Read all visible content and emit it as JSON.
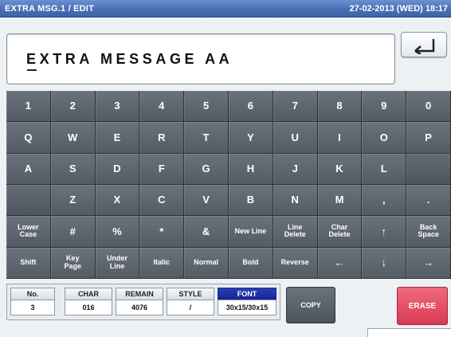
{
  "header": {
    "title": "EXTRA MSG.1 / EDIT",
    "datetime": "27-02-2013 (WED) 18:17"
  },
  "message": {
    "text": "EXTRA MESSAGE AA"
  },
  "icons": {
    "back": "return-arrow-icon"
  },
  "keyboard": {
    "rows": [
      [
        "1",
        "2",
        "3",
        "4",
        "5",
        "6",
        "7",
        "8",
        "9",
        "0"
      ],
      [
        "Q",
        "W",
        "E",
        "R",
        "T",
        "Y",
        "U",
        "I",
        "O",
        "P"
      ],
      [
        "A",
        "S",
        "D",
        "F",
        "G",
        "H",
        "J",
        "K",
        "L",
        ""
      ],
      [
        "",
        "Z",
        "X",
        "C",
        "V",
        "B",
        "N",
        "M",
        ",",
        "."
      ],
      [
        "Lower\nCase",
        "#",
        "%",
        "*",
        "&",
        "New Line",
        "Line\nDelete",
        "Char\nDelete",
        "↑",
        "Back\nSpace"
      ],
      [
        "Shift",
        "Key\nPage",
        "Under\nLine",
        "Italic",
        "Normal",
        "Bold",
        "Reverse",
        "←",
        "↓",
        "→"
      ]
    ]
  },
  "status": {
    "no_label": "No.",
    "no_value": "3",
    "char_label": "CHAR",
    "char_value": "016",
    "remain_label": "REMAIN",
    "remain_value": "4076",
    "style_label": "STYLE",
    "style_value": "/",
    "font_label": "FONT",
    "font_value": "30x15/30x15"
  },
  "actions": {
    "copy_label": "COPY",
    "erase_label": "ERASE"
  },
  "colors": {
    "titlebar": "#4a6fb6",
    "key": "#5f6870",
    "font_header": "#1a2ea6",
    "erase": "#e04a62"
  }
}
